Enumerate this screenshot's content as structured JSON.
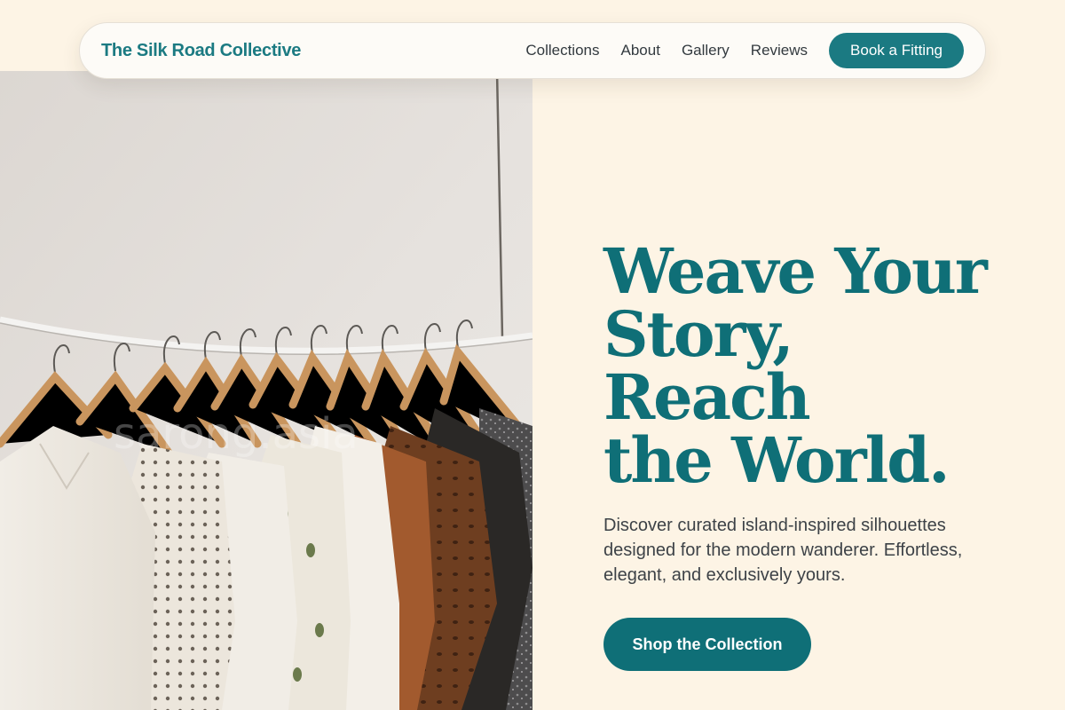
{
  "nav": {
    "brand": "The Silk Road Collective",
    "links": [
      "Collections",
      "About",
      "Gallery",
      "Reviews"
    ],
    "cta_label": "Book a Fitting"
  },
  "hero": {
    "headline_lines": [
      "Weave Your",
      "Story, Reach",
      "the World."
    ],
    "subtext": "Discover curated island-inspired silhouettes designed for the modern wanderer. Effortless, elegant, and exclusively yours.",
    "cta_label": "Shop the Collection",
    "image_watermark": "sarong.asia"
  },
  "colors": {
    "page_background": "#fdf4e5",
    "accent_teal": "#0f6f77",
    "brand_teal": "#1b7a82",
    "body_text": "#3d4247"
  }
}
